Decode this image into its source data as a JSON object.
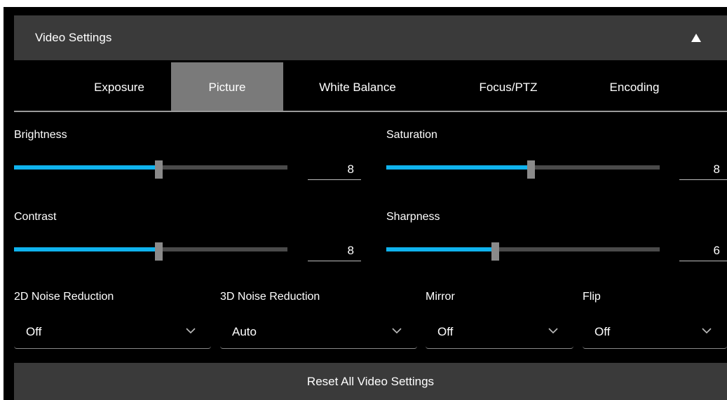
{
  "header": {
    "title": "Video Settings",
    "collapse_icon": "triangle-up-icon"
  },
  "tabs": [
    {
      "label": "Exposure",
      "active": false
    },
    {
      "label": "Picture",
      "active": true
    },
    {
      "label": "White Balance",
      "active": false
    },
    {
      "label": "Focus/PTZ",
      "active": false
    },
    {
      "label": "Encoding",
      "active": false
    }
  ],
  "sliders": {
    "brightness": {
      "label": "Brightness",
      "value": "8",
      "fraction": 0.53
    },
    "saturation": {
      "label": "Saturation",
      "value": "8",
      "fraction": 0.53
    },
    "contrast": {
      "label": "Contrast",
      "value": "8",
      "fraction": 0.53
    },
    "sharpness": {
      "label": "Sharpness",
      "value": "6",
      "fraction": 0.4
    }
  },
  "selects": {
    "noise2d": {
      "label": "2D Noise Reduction",
      "value": "Off"
    },
    "noise3d": {
      "label": "3D Noise Reduction",
      "value": "Auto"
    },
    "mirror": {
      "label": "Mirror",
      "value": "Off"
    },
    "flip": {
      "label": "Flip",
      "value": "Off"
    }
  },
  "reset_label": "Reset All Video Settings",
  "colors": {
    "accent": "#0fb3ee",
    "panel": "#3a3a3a",
    "active_tab": "#7a7a7a",
    "background": "#000000"
  }
}
